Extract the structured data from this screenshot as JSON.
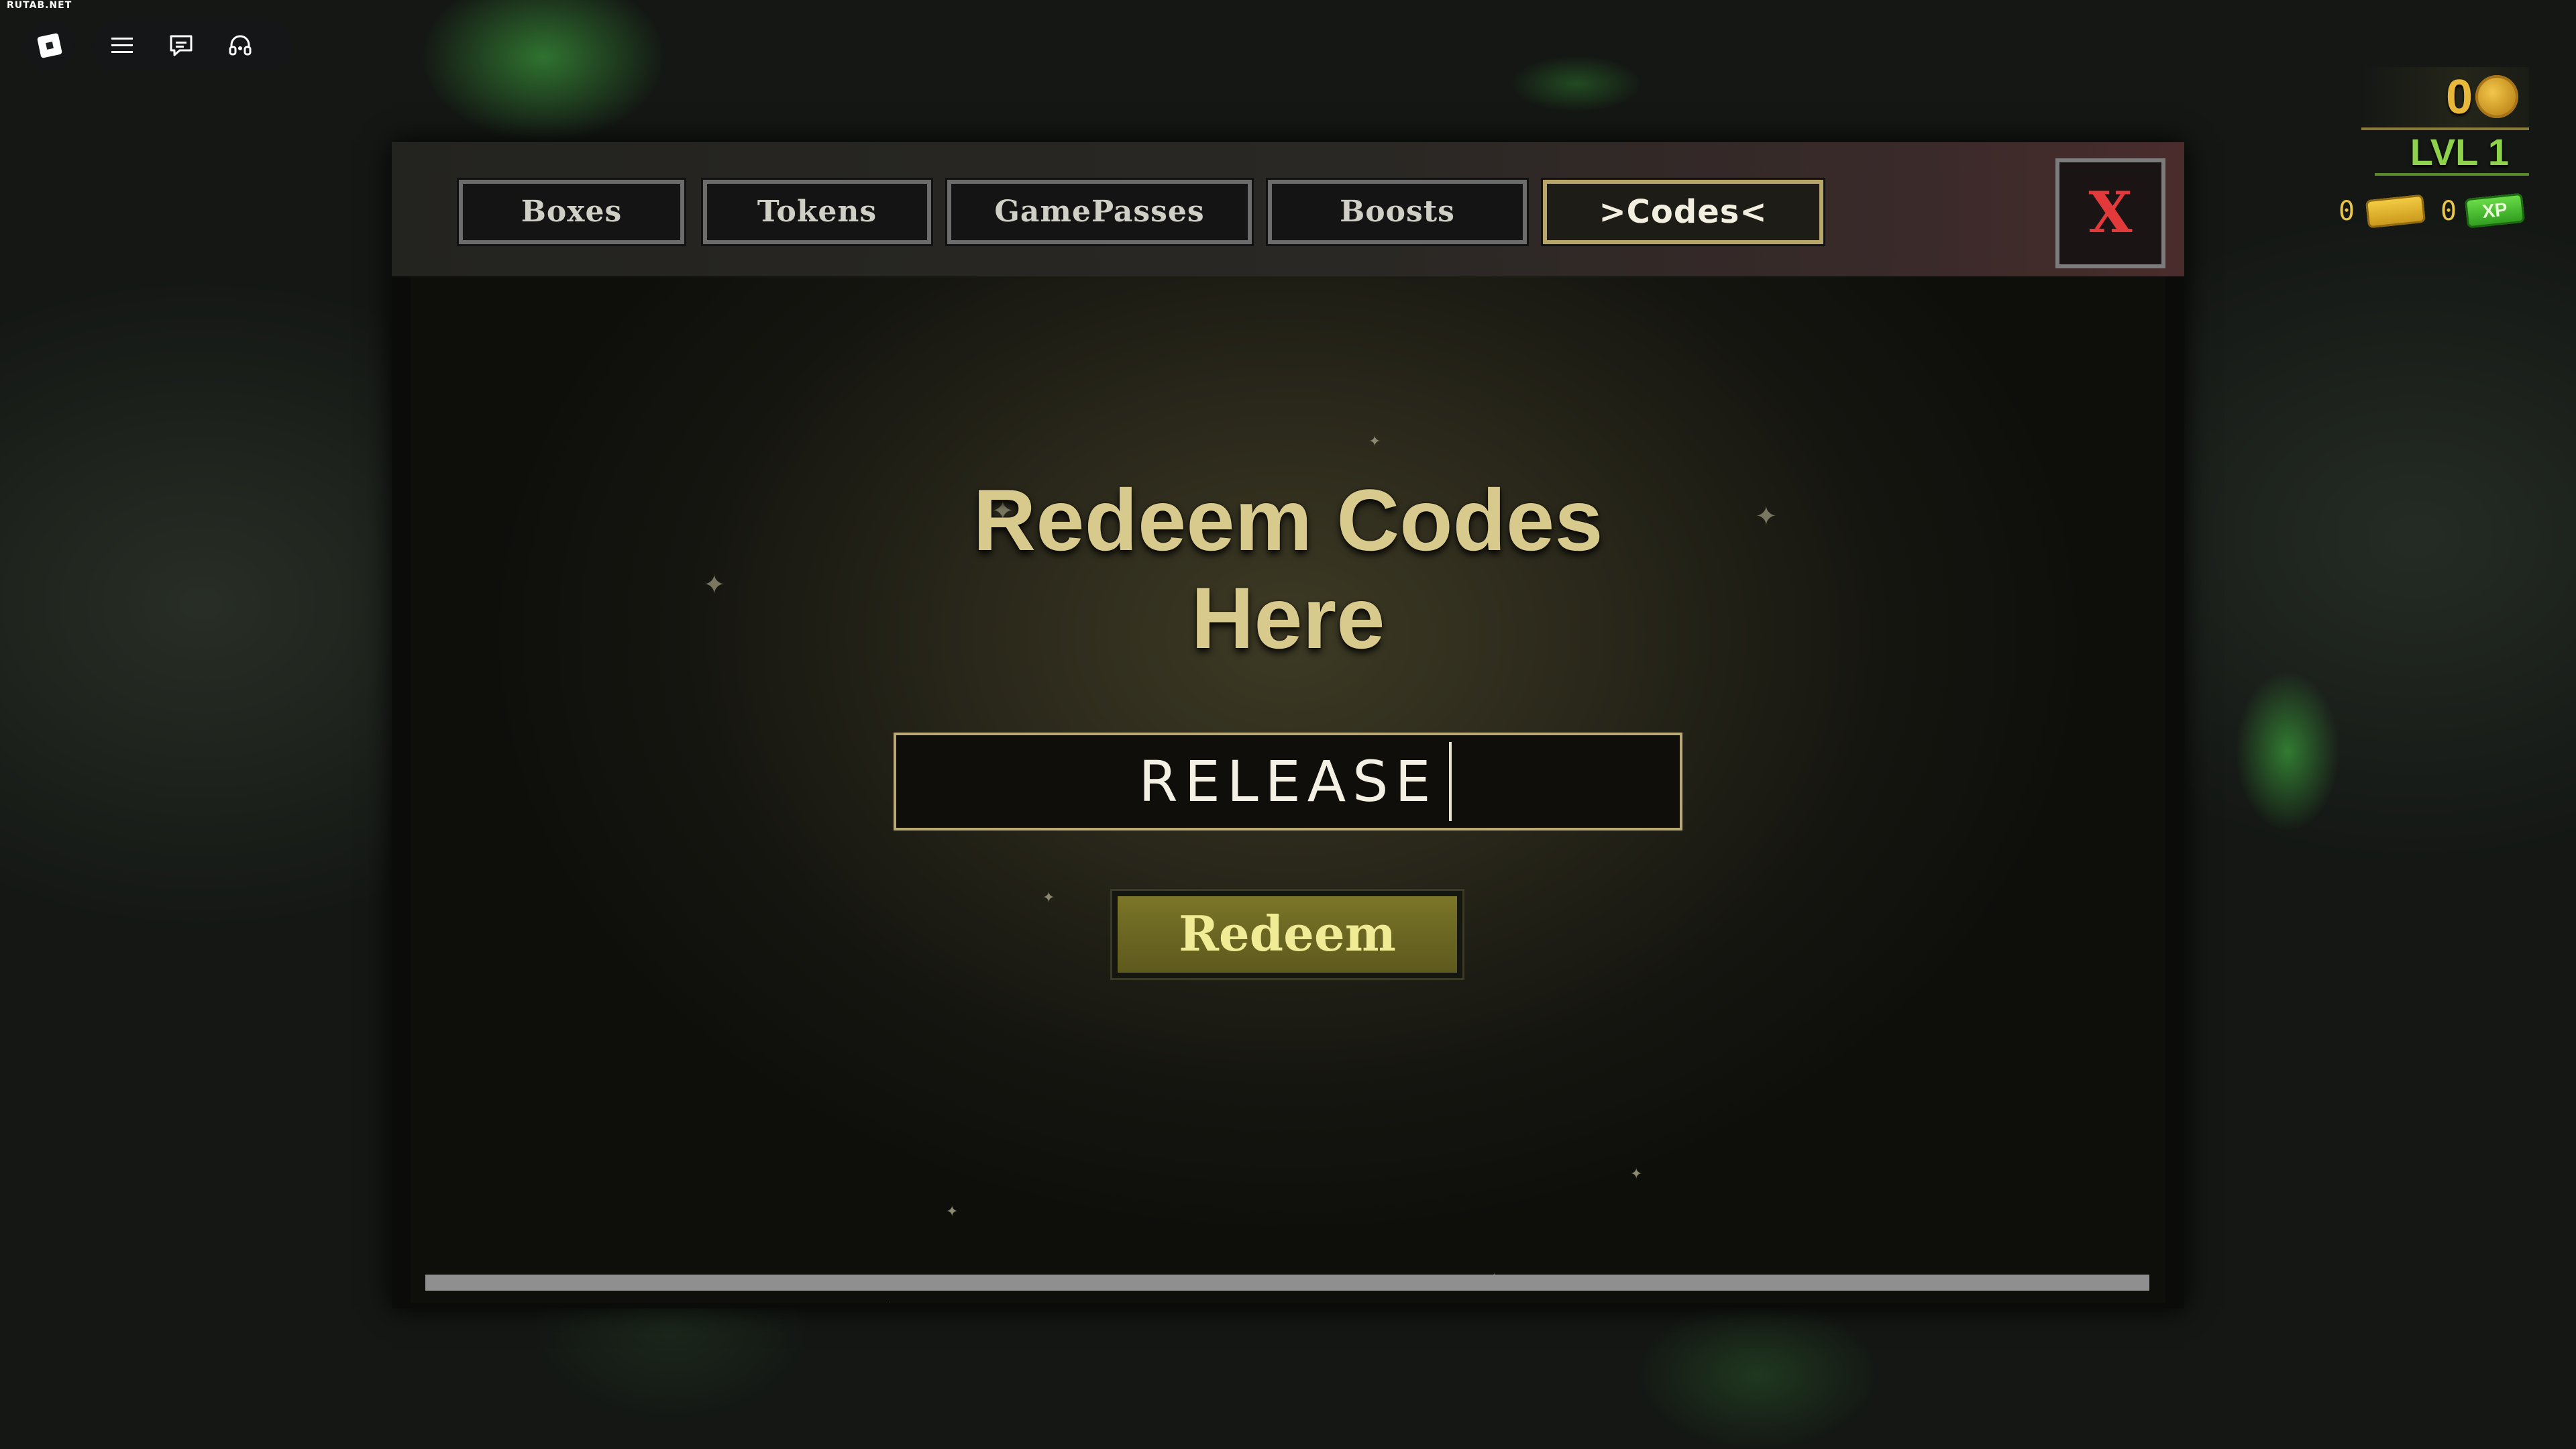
{
  "watermark": "RUTAB.NET",
  "roblox_bar": {
    "logo_icon": "roblox-logo-icon",
    "icons": [
      "menu-icon",
      "chat-icon",
      "headset-icon"
    ]
  },
  "tabs": [
    {
      "label": "Boxes",
      "active": false
    },
    {
      "label": "Tokens",
      "active": false
    },
    {
      "label": "GamePasses",
      "active": false
    },
    {
      "label": "Boosts",
      "active": false
    },
    {
      "label": ">Codes<",
      "active": true
    }
  ],
  "close_label": "X",
  "title_line1": "Redeem Codes",
  "title_line2": "Here",
  "code_input_value": "RELEASE",
  "redeem_label": "Redeem",
  "hud": {
    "coins": "0",
    "level": "LVL 1",
    "tickets": "0",
    "xp_boosts": "0",
    "xp_icon_label": "XP"
  },
  "colors": {
    "accent_gold": "#d8c98c",
    "close_red": "#e23a3a",
    "level_green": "#8ed14a",
    "coin_gold": "#e8b83a"
  }
}
